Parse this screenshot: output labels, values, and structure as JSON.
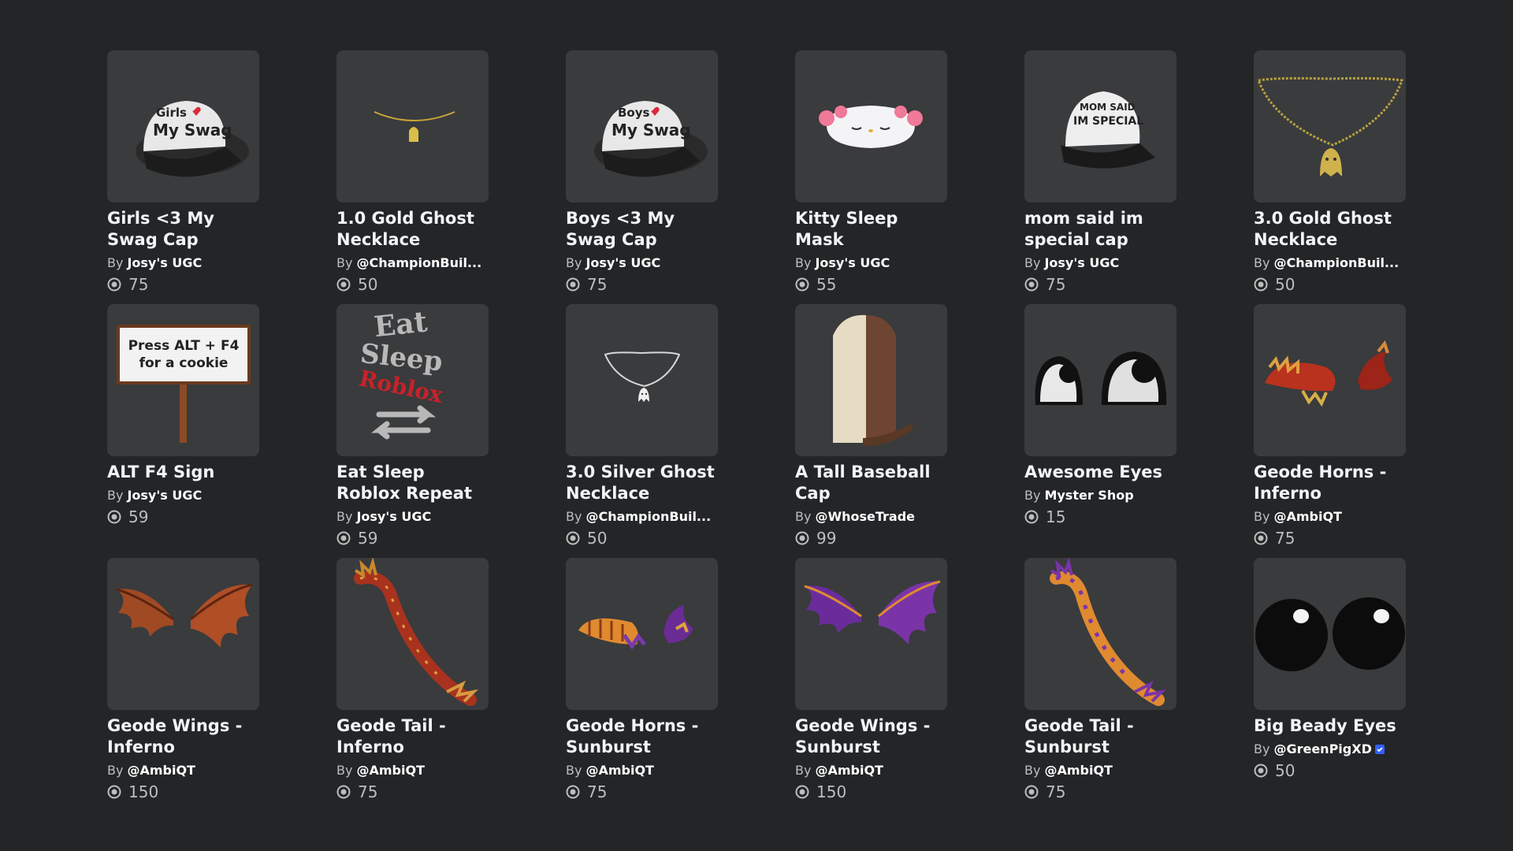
{
  "items": [
    {
      "name": "Girls <3 My Swag Cap",
      "by": "By",
      "creator": "Josy's UGC",
      "verified": false,
      "price": "75",
      "icon": "girls-swag-cap-icon"
    },
    {
      "name": "1.0 Gold Ghost Necklace",
      "by": "By",
      "creator": "@ChampionBuil...",
      "verified": true,
      "price": "50",
      "icon": "gold-ghost-necklace-icon"
    },
    {
      "name": "Boys <3 My Swag Cap",
      "by": "By",
      "creator": "Josy's UGC",
      "verified": false,
      "price": "75",
      "icon": "boys-swag-cap-icon"
    },
    {
      "name": "Kitty Sleep Mask",
      "by": "By",
      "creator": "Josy's UGC",
      "verified": false,
      "price": "55",
      "icon": "kitty-sleep-mask-icon"
    },
    {
      "name": "mom said im special cap",
      "by": "By",
      "creator": "Josy's UGC",
      "verified": false,
      "price": "75",
      "icon": "special-cap-icon"
    },
    {
      "name": "3.0 Gold Ghost Necklace",
      "by": "By",
      "creator": "@ChampionBuil...",
      "verified": true,
      "price": "50",
      "icon": "gold-ghost-necklace-large-icon"
    },
    {
      "name": "ALT F4 Sign",
      "by": "By",
      "creator": "Josy's UGC",
      "verified": false,
      "price": "59",
      "icon": "alt-f4-sign-icon",
      "sign_text_1": "Press ALT + F4",
      "sign_text_2": "for a cookie"
    },
    {
      "name": "Eat Sleep Roblox Repeat",
      "by": "By",
      "creator": "Josy's UGC",
      "verified": false,
      "price": "59",
      "icon": "eat-sleep-roblox-icon",
      "art_text_1": "Eat",
      "art_text_2": "Sleep",
      "art_text_3": "Roblox"
    },
    {
      "name": "3.0 Silver Ghost Necklace",
      "by": "By",
      "creator": "@ChampionBuil...",
      "verified": true,
      "price": "50",
      "icon": "silver-ghost-necklace-icon"
    },
    {
      "name": "A Tall Baseball Cap",
      "by": "By",
      "creator": "@WhoseTrade",
      "verified": false,
      "price": "99",
      "icon": "tall-baseball-cap-icon"
    },
    {
      "name": "Awesome Eyes",
      "by": "By",
      "creator": "Myster Shop",
      "verified": false,
      "price": "15",
      "icon": "awesome-eyes-icon"
    },
    {
      "name": "Geode Horns - Inferno",
      "by": "By",
      "creator": "@AmbiQT",
      "verified": false,
      "price": "75",
      "icon": "geode-horns-inferno-icon"
    },
    {
      "name": "Geode Wings - Inferno",
      "by": "By",
      "creator": "@AmbiQT",
      "verified": false,
      "price": "150",
      "icon": "geode-wings-inferno-icon"
    },
    {
      "name": "Geode Tail - Inferno",
      "by": "By",
      "creator": "@AmbiQT",
      "verified": false,
      "price": "75",
      "icon": "geode-tail-inferno-icon"
    },
    {
      "name": "Geode Horns - Sunburst",
      "by": "By",
      "creator": "@AmbiQT",
      "verified": false,
      "price": "75",
      "icon": "geode-horns-sunburst-icon"
    },
    {
      "name": "Geode Wings - Sunburst",
      "by": "By",
      "creator": "@AmbiQT",
      "verified": false,
      "price": "150",
      "icon": "geode-wings-sunburst-icon"
    },
    {
      "name": "Geode Tail - Sunburst",
      "by": "By",
      "creator": "@AmbiQT",
      "verified": false,
      "price": "75",
      "icon": "geode-tail-sunburst-icon"
    },
    {
      "name": "Big Beady Eyes",
      "by": "By",
      "creator": "@GreenPigXD",
      "verified": true,
      "price": "50",
      "icon": "big-beady-eyes-icon"
    }
  ],
  "colors": {
    "background": "#232527",
    "card": "#393b3d",
    "verified": "#335fff",
    "muted": "#bdbebe"
  }
}
